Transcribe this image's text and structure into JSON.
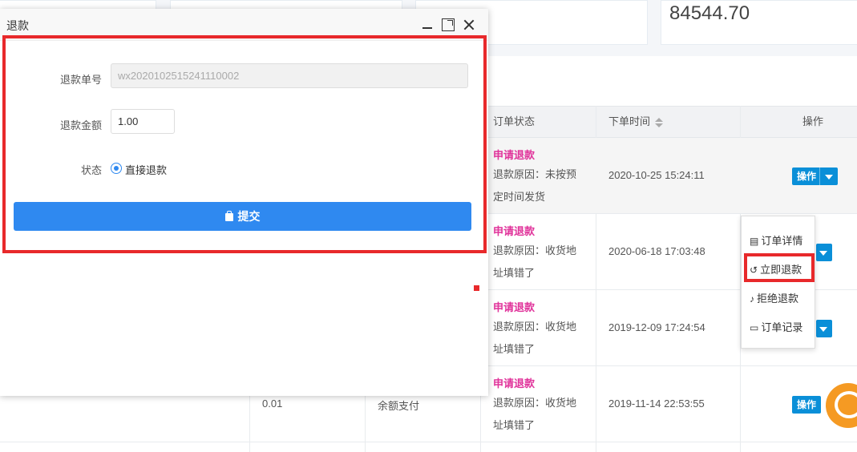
{
  "stats": {
    "card1_value": "",
    "card2_value": "",
    "card3_value": "",
    "card4_value": "84544.70"
  },
  "table": {
    "headers": {
      "order_status": "订单状态",
      "order_time": "下单时间",
      "actions": "操作"
    },
    "rows": [
      {
        "status": "申请退款",
        "reason": "退款原因：未按预定时间发货",
        "time": "2020-10-25 15:24:11",
        "amount": "",
        "payment": ""
      },
      {
        "status": "申请退款",
        "reason": "退款原因：收货地址填错了",
        "time": "2020-06-18 17:03:48",
        "amount": "",
        "payment": ""
      },
      {
        "status": "申请退款",
        "reason": "退款原因：收货地址填错了",
        "time": "2019-12-09 17:24:54",
        "amount": "",
        "payment": ""
      },
      {
        "status": "申请退款",
        "reason": "退款原因：收货地址填错了",
        "time": "2019-11-14 22:53:55",
        "amount": "0.01",
        "payment": "余额支付"
      }
    ],
    "op_button_label": "操作"
  },
  "dropdown": {
    "items": [
      {
        "label": "订单详情",
        "icon": "file-icon"
      },
      {
        "label": "立即退款",
        "icon": "refund-icon"
      },
      {
        "label": "拒绝退款",
        "icon": "reject-icon"
      },
      {
        "label": "订单记录",
        "icon": "record-icon"
      }
    ]
  },
  "modal": {
    "title": "退款",
    "form": {
      "refund_no_label": "退款单号",
      "refund_no_value": "wx2020102515241110002",
      "refund_amount_label": "退款金额",
      "refund_amount_value": "1.00",
      "status_label": "状态",
      "status_option": "直接退款",
      "submit_label": "提交"
    }
  },
  "colors": {
    "primary": "#2f89f0",
    "status_pink": "#e0329a",
    "highlight_red": "#e8292b",
    "op_blue": "#0a8fd8",
    "support_orange": "#f59a23"
  }
}
